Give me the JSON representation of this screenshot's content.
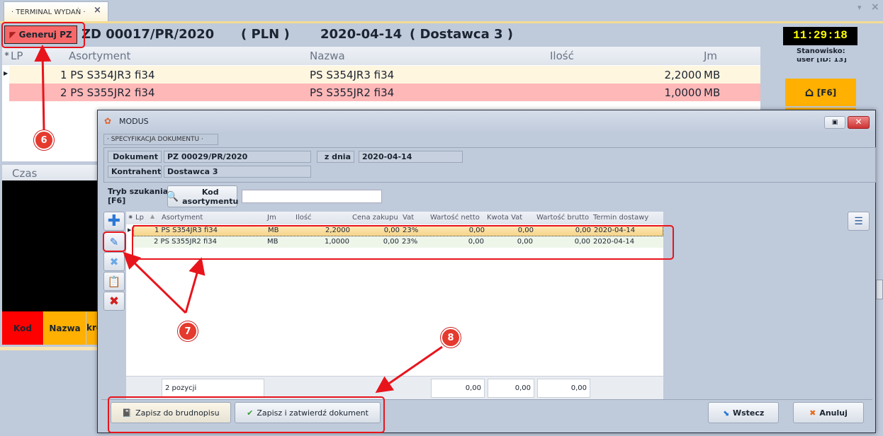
{
  "tab": {
    "label": "· TERMINAL WYDAŃ ·",
    "close": "×"
  },
  "window_controls": {
    "menu": "▾",
    "close": "×"
  },
  "header": {
    "generate_button": "Generuj PZ",
    "doc_number": "ZD 00017/PR/2020",
    "currency": "( PLN )",
    "date": "2020-04-14",
    "supplier": "( Dostawca 3 )"
  },
  "clock": "11:29:18",
  "station": {
    "label": "Stanowisko:",
    "value": "user [ID: 13]"
  },
  "home_button": "[F6]",
  "main_grid": {
    "columns": [
      "LP",
      "Asortyment",
      "Nazwa",
      "Ilość",
      "Jm"
    ],
    "rows": [
      {
        "lp_asortyment": "1 PS S354JR3 fi34",
        "nazwa": "PS S354JR3 fi34",
        "ilosc": "2,2000",
        "jm": "MB"
      },
      {
        "lp_asortyment": "2 PS S355JR2 fi34",
        "nazwa": "PS S355JR2 fi34",
        "ilosc": "1,0000",
        "jm": "MB"
      }
    ]
  },
  "log": {
    "header": "Czas",
    "buttons": [
      "Kod",
      "Nazwa",
      "kre"
    ]
  },
  "modal": {
    "title": "MODUS",
    "group": "· SPECYFIKACJA DOKUMENTU ·",
    "dokument_label": "Dokument",
    "dokument": "PZ 00029/PR/2020",
    "zdnia_label": "z dnia",
    "zdnia": "2020-04-14",
    "kontrahent_label": "Kontrahent",
    "kontrahent": "Dostawca 3",
    "search_mode": "Tryb szukania",
    "search_key": "[F6]",
    "search_button": [
      "Kod",
      "asortymentu"
    ],
    "search_value": "",
    "grid": {
      "columns": [
        "Lp",
        "Asortyment",
        "Jm",
        "Ilość",
        "Cena zakupu",
        "Vat",
        "Wartość netto",
        "Kwota Vat",
        "Wartość brutto",
        "Termin dostawy"
      ],
      "rows": [
        {
          "lp_asortyment": "1 PS S354JR3 fi34",
          "jm": "MB",
          "ilosc": "2,2000",
          "cena": "0,00",
          "vat": "23%",
          "netto": "0,00",
          "kwota": "0,00",
          "brutto": "0,00",
          "termin": "2020-04-14"
        },
        {
          "lp_asortyment": "2 PS S355JR2 fi34",
          "jm": "MB",
          "ilosc": "1,0000",
          "cena": "0,00",
          "vat": "23%",
          "netto": "0,00",
          "kwota": "0,00",
          "brutto": "0,00",
          "termin": "2020-04-14"
        }
      ],
      "footer": {
        "count": "2 pozycji",
        "netto": "0,00",
        "kwota": "0,00",
        "brutto": "0,00"
      }
    },
    "buttons": {
      "draft": "Zapisz do brudnopisu",
      "confirm": "Zapisz i zatwierdź dokument",
      "back": "Wstecz",
      "cancel": "Anuluj"
    }
  },
  "annotations": [
    "6",
    "7",
    "8"
  ]
}
